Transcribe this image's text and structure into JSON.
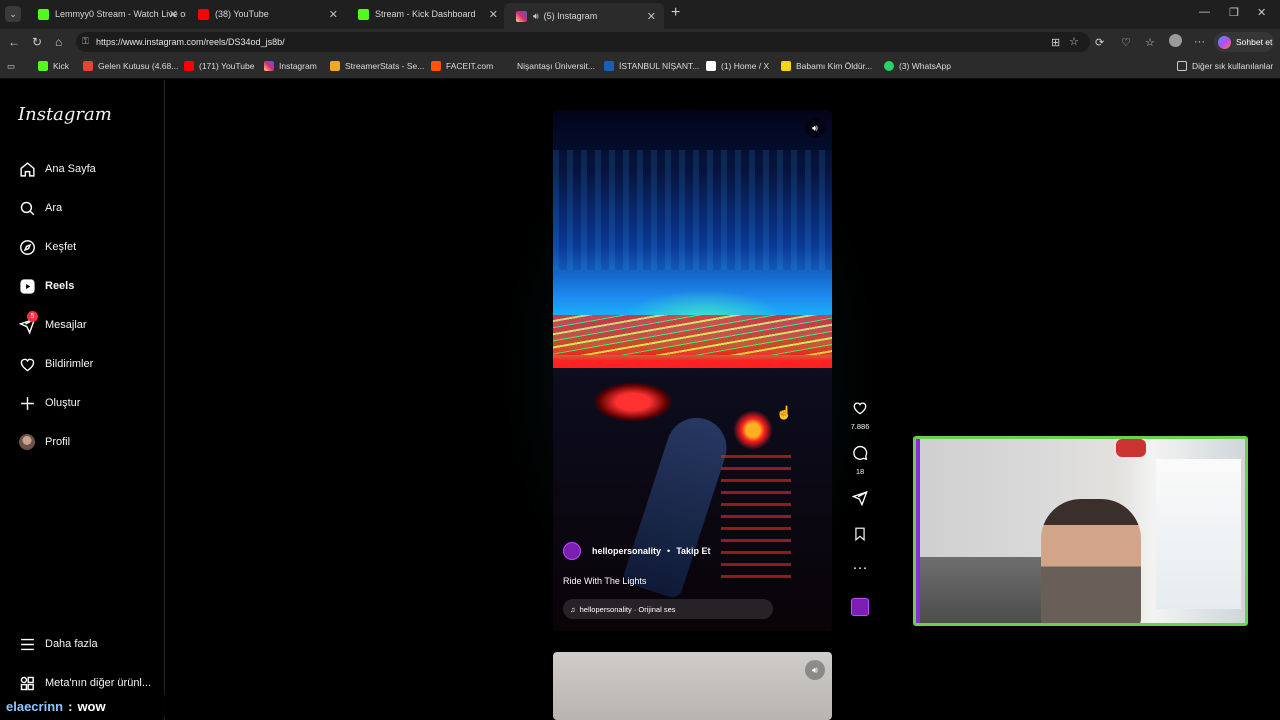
{
  "browser": {
    "tabs": [
      {
        "title": "Lemmyy0 Stream - Watch Live on",
        "favicon": "kick-icon",
        "color": "#53fc18"
      },
      {
        "title": "(38) YouTube",
        "favicon": "youtube-icon",
        "color": "#ff0000"
      },
      {
        "title": "Stream - Kick Dashboard",
        "favicon": "kick-icon",
        "color": "#53fc18"
      },
      {
        "title": "(5) Instagram",
        "favicon": "instagram-icon",
        "color": "#e1306c",
        "active": true
      }
    ],
    "url": "https://www.instagram.com/reels/DS34od_js8b/",
    "copilot_label": "Sohbet et",
    "bookmarks": [
      {
        "label": "Kick",
        "icon": "kick-icon",
        "color": "#53fc18"
      },
      {
        "label": "Gelen Kutusu (4.68...",
        "icon": "gmail-icon",
        "color": "#ea4335"
      },
      {
        "label": "(171) YouTube",
        "icon": "youtube-icon",
        "color": "#ff0000"
      },
      {
        "label": "Instagram",
        "icon": "instagram-icon",
        "color": "#e1306c"
      },
      {
        "label": "StreamerStats - Se...",
        "icon": "chart-icon",
        "color": "#f5a623"
      },
      {
        "label": "FACEIT.com",
        "icon": "faceit-icon",
        "color": "#ff5500"
      },
      {
        "label": "Nişantaşı Üniversit...",
        "icon": "university-icon",
        "color": "#2b2b2b"
      },
      {
        "label": "İSTANBUL NİŞANT...",
        "icon": "university-icon",
        "color": "#1a5fb4"
      },
      {
        "label": "(1) Home / X",
        "icon": "x-icon",
        "color": "#ffffff"
      },
      {
        "label": "Babamı Kim Öldür...",
        "icon": "bookmark-icon",
        "color": "#f5d90a"
      },
      {
        "label": "(3) WhatsApp",
        "icon": "whatsapp-icon",
        "color": "#25d366"
      }
    ],
    "other_bookmarks": "Diğer sık kullanılanlar"
  },
  "sidebar": {
    "logo": "Instagram",
    "items": [
      {
        "label": "Ana Sayfa",
        "icon": "home-icon"
      },
      {
        "label": "Ara",
        "icon": "search-icon"
      },
      {
        "label": "Keşfet",
        "icon": "compass-icon"
      },
      {
        "label": "Reels",
        "icon": "reels-icon",
        "active": true
      },
      {
        "label": "Mesajlar",
        "icon": "messenger-icon",
        "badge": "5"
      },
      {
        "label": "Bildirimler",
        "icon": "heart-icon"
      },
      {
        "label": "Oluştur",
        "icon": "plus-icon"
      },
      {
        "label": "Profil",
        "icon": "avatar"
      }
    ],
    "more": "Daha fazla",
    "meta": "Meta'nın diğer ürünl..."
  },
  "reel": {
    "username": "hellopersonality",
    "separator": "•",
    "follow": "Takip Et",
    "caption": "Ride With The Lights",
    "audio": "hellopersonality · Orijinal ses",
    "likes": "7.886",
    "comments": "18"
  },
  "chat": {
    "user": "elaecrinn",
    "separator": ":",
    "message": "wow"
  }
}
